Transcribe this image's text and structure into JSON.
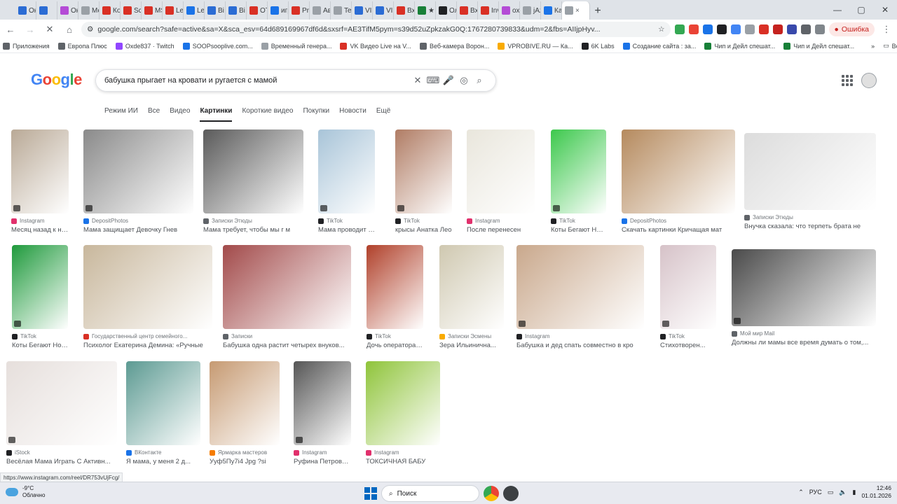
{
  "browser": {
    "tabs": [
      {
        "label": "Ок",
        "color": "#2b6cd4"
      },
      {
        "label": "",
        "color": "#2b6cd4"
      },
      {
        "label": "Ок",
        "color": "#b44bd6"
      },
      {
        "label": "Ме",
        "color": "#9aa0a6"
      },
      {
        "label": "Ко",
        "color": "#d93025"
      },
      {
        "label": "Sca",
        "color": "#d93025"
      },
      {
        "label": "МS",
        "color": "#d93025"
      },
      {
        "label": "Le\\",
        "color": "#d93025"
      },
      {
        "label": "Le\\",
        "color": "#1a73e8"
      },
      {
        "label": "Ві",
        "color": "#2b6cd4"
      },
      {
        "label": "Ві",
        "color": "#2b6cd4"
      },
      {
        "label": "ОТ",
        "color": "#d93025"
      },
      {
        "label": "игр",
        "color": "#1a73e8"
      },
      {
        "label": "Pro",
        "color": "#d93025"
      },
      {
        "label": "Ав",
        "color": "#9aa0a6"
      },
      {
        "label": "Tel",
        "color": "#9aa0a6"
      },
      {
        "label": "VIC",
        "color": "#2b6cd4"
      },
      {
        "label": "VIL",
        "color": "#2b6cd4"
      },
      {
        "label": "Вх",
        "color": "#d93025"
      },
      {
        "label": "★",
        "color": "#188038"
      },
      {
        "label": "Ол",
        "color": "#202124"
      },
      {
        "label": "Вх",
        "color": "#d93025"
      },
      {
        "label": "Inv",
        "color": "#d93025"
      },
      {
        "label": "оxс",
        "color": "#b44bd6"
      },
      {
        "label": "jAz",
        "color": "#9aa0a6"
      },
      {
        "label": "Ка",
        "color": "#1a73e8"
      }
    ],
    "active_tab_close": "×",
    "new_tab": "+",
    "window_controls": [
      "—",
      "▢",
      "✕"
    ],
    "url": "google.com/search?safe=active&sa=X&sca_esv=64d689169967df6d&sxsrf=AE3TifM5pym=s39d52uZpkzakG0Q:1767280739833&udm=2&fbs=AIIjpHyv...",
    "error_button": "Ошибка",
    "bookmarks": [
      {
        "label": "Приложения",
        "color": "#5f6368"
      },
      {
        "label": "Европа Плюс",
        "color": "#5f6368"
      },
      {
        "label": "Oxde837 · Twitch",
        "color": "#9146ff"
      },
      {
        "label": "SOOPsooplive.com...",
        "color": "#1a73e8"
      },
      {
        "label": "Временный генера...",
        "color": "#9aa0a6"
      },
      {
        "label": "VK Видео Live на V...",
        "color": "#d93025"
      },
      {
        "label": "Веб-камера Ворон...",
        "color": "#5f6368"
      },
      {
        "label": "VPROBIVE.RU — Ка...",
        "color": "#f9ab00"
      },
      {
        "label": "6K Labs",
        "color": "#202124"
      },
      {
        "label": "Создание сайта : за...",
        "color": "#1a73e8"
      },
      {
        "label": "Чип и Дейл спешат...",
        "color": "#188038"
      },
      {
        "label": "Чип и Дейл спешат...",
        "color": "#188038"
      }
    ],
    "bookmarks_more": "»",
    "all_bookmarks": "Все закладки"
  },
  "google": {
    "logo": "Google",
    "query": "бабушка прыгает на кровати и ругается с мамой",
    "tabs": [
      "Режим ИИ",
      "Все",
      "Видео",
      "Картинки",
      "Короткие видео",
      "Покупки",
      "Новости",
      "Ещё"
    ],
    "active_tab": "Картинки"
  },
  "results": [
    {
      "source": "Instagram",
      "title": "Месяц назад к на...",
      "color": "#b9a996",
      "src_color": "#e1306c",
      "video": true
    },
    {
      "source": "DepositPhotos",
      "title": "Мама защищает Девочку Гнев",
      "color": "#8a8a8a",
      "src_color": "#1a73e8",
      "video": true
    },
    {
      "source": "Записки Этюды",
      "title": "Мама требует, чтобы мы г м",
      "color": "#5a5a5a",
      "src_color": "#5f6368",
      "video": false
    },
    {
      "source": "TikTok",
      "title": "Мама проводит с...",
      "color": "#a8c4d8",
      "src_color": "#202124",
      "video": true
    },
    {
      "source": "TikTok",
      "title": "крысы Анатка Лео",
      "color": "#b07c64",
      "src_color": "#202124",
      "video": true
    },
    {
      "source": "Instagram",
      "title": "После перенесен",
      "color": "#e9e6dc",
      "src_color": "#e1306c",
      "video": false
    },
    {
      "source": "TikTok",
      "title": "Коты Бегают Ночь",
      "color": "#3cc84c",
      "src_color": "#202124",
      "video": true
    },
    {
      "source": "DepositPhotos",
      "title": "Скачать картинки Кричащая мат",
      "color": "#b58a5e",
      "src_color": "#1a73e8",
      "video": false
    },
    {
      "source": "Записки Этюды",
      "title": "Внучка сказала: что терпеть брата не",
      "color": "#dcdcdc",
      "src_color": "#5f6368",
      "video": false
    },
    {
      "source": "TikTok",
      "title": "Коты Бегают Ночь",
      "color": "#1f9a3c",
      "src_color": "#202124",
      "video": true
    },
    {
      "source": "Государственный центр семейного...",
      "title": "Психолог Екатерина Демина: «Ручные",
      "color": "#c8b79c",
      "src_color": "#d93025",
      "video": false
    },
    {
      "source": "Записки",
      "title": "Бабушка одна растит четырех внуков...",
      "color": "#a24a4a",
      "src_color": "#5f6368",
      "video": false
    },
    {
      "source": "TikTok",
      "title": "Дочь оператора отц",
      "color": "#b0402a",
      "src_color": "#202124",
      "video": false
    },
    {
      "source": "Записки Эсмены",
      "title": "Зера Ильинична...",
      "color": "#cfc8b0",
      "src_color": "#f9ab00",
      "video": false
    },
    {
      "source": "Instagram",
      "title": "Бабушка и дед спать совместно в кро",
      "color": "#c9a88c",
      "src_color": "#202124",
      "video": true
    },
    {
      "source": "TikTok",
      "title": "Стихотворен...",
      "color": "#d6c2c8",
      "src_color": "#202124",
      "video": true
    },
    {
      "source": "Мой мир Mail",
      "title": "Должны ли мамы все время думать о том,...",
      "color": "#4a4a4a",
      "src_color": "#5f6368",
      "video": true
    },
    {
      "source": "iStock",
      "title": "Весёлая Мама Играть С Активн...",
      "color": "#e6dfdc",
      "src_color": "#202124",
      "video": true
    },
    {
      "source": "ВКонтакте",
      "title": "Я мама, у меня 2 д...",
      "color": "#5c9a92",
      "src_color": "#1a73e8",
      "video": false
    },
    {
      "source": "Ярмарка мастеров",
      "title": "Ууф5Пу7i4 Jpg ?si",
      "color": "#c69a72",
      "src_color": "#f57c00",
      "video": false
    },
    {
      "source": "Instagram",
      "title": "Руфина Петровна...",
      "color": "#555",
      "src_color": "#e1306c",
      "video": true
    },
    {
      "source": "Instagram",
      "title": "ТОКСИЧНАЯ БАБУ",
      "color": "#8fc43a",
      "src_color": "#e1306c",
      "video": false
    }
  ],
  "status_url": "https://www.instagram.com/reel/DR753vUjFcg/",
  "taskbar": {
    "temp": "-9°C",
    "weather": "Облачно",
    "search": "Поиск",
    "lang": "РУС",
    "time": "12:46",
    "date": "01.01.2026"
  }
}
